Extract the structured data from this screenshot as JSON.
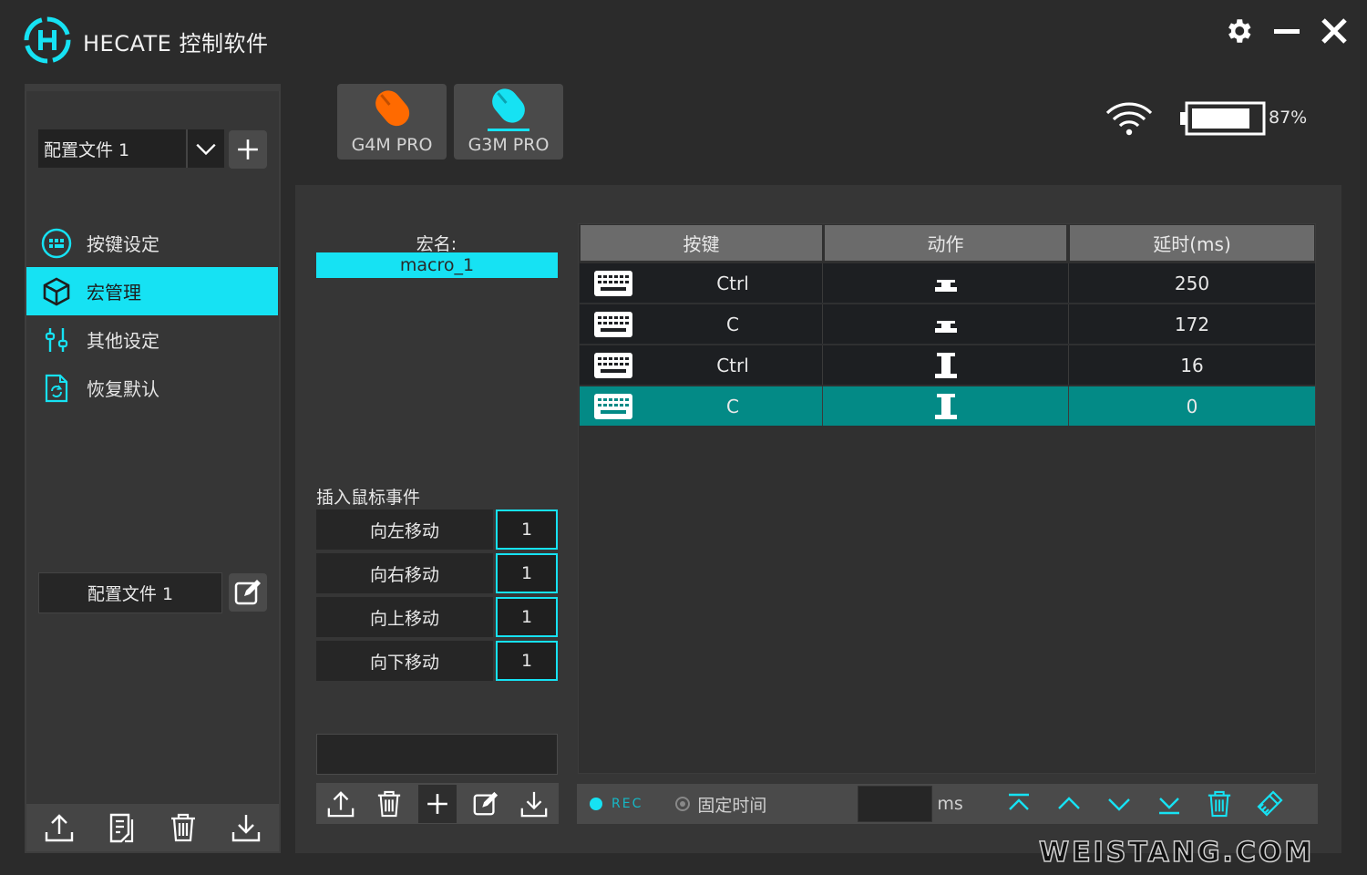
{
  "app": {
    "title": "HECATE 控制软件"
  },
  "window_controls": {
    "settings_icon": "gear-icon",
    "minimize_icon": "minimize-icon",
    "close_icon": "close-icon"
  },
  "sidebar": {
    "profile_select": {
      "value": "配置文件 1"
    },
    "nav": [
      {
        "label": "按键设定",
        "icon": "keypad-icon",
        "active": false
      },
      {
        "label": "宏管理",
        "icon": "cube-icon",
        "active": true
      },
      {
        "label": "其他设定",
        "icon": "sliders-icon",
        "active": false
      },
      {
        "label": "恢复默认",
        "icon": "restore-icon",
        "active": false
      }
    ],
    "profile_name": "配置文件 1"
  },
  "devices": [
    {
      "label": "G4M PRO",
      "color": "#ff6a00",
      "selected": false
    },
    {
      "label": "G3M PRO",
      "color": "#16e2f3",
      "selected": true
    }
  ],
  "status": {
    "battery": "87%"
  },
  "macro": {
    "name_label": "宏名:",
    "name_value": "macro_1",
    "insert_label": "插入鼠标事件",
    "moves": [
      {
        "label": "向左移动",
        "value": "1"
      },
      {
        "label": "向右移动",
        "value": "1"
      },
      {
        "label": "向上移动",
        "value": "1"
      },
      {
        "label": "向下移动",
        "value": "1"
      }
    ]
  },
  "table": {
    "headers": [
      "按键",
      "动作",
      "延时(ms)"
    ],
    "rows": [
      {
        "key": "Ctrl",
        "action": "release",
        "delay": "250",
        "selected": false
      },
      {
        "key": "C",
        "action": "release",
        "delay": "172",
        "selected": false
      },
      {
        "key": "Ctrl",
        "action": "press",
        "delay": "16",
        "selected": false
      },
      {
        "key": "C",
        "action": "press",
        "delay": "0",
        "selected": true
      }
    ]
  },
  "record_bar": {
    "rec_label": "REC",
    "fixed_time_label": "固定时间",
    "ms_value": "",
    "ms_unit": "ms"
  },
  "watermark": "WEISTANG.COM",
  "colors": {
    "accent": "#16e2f3",
    "selected_row": "#038a86",
    "orange": "#ff6a00"
  }
}
